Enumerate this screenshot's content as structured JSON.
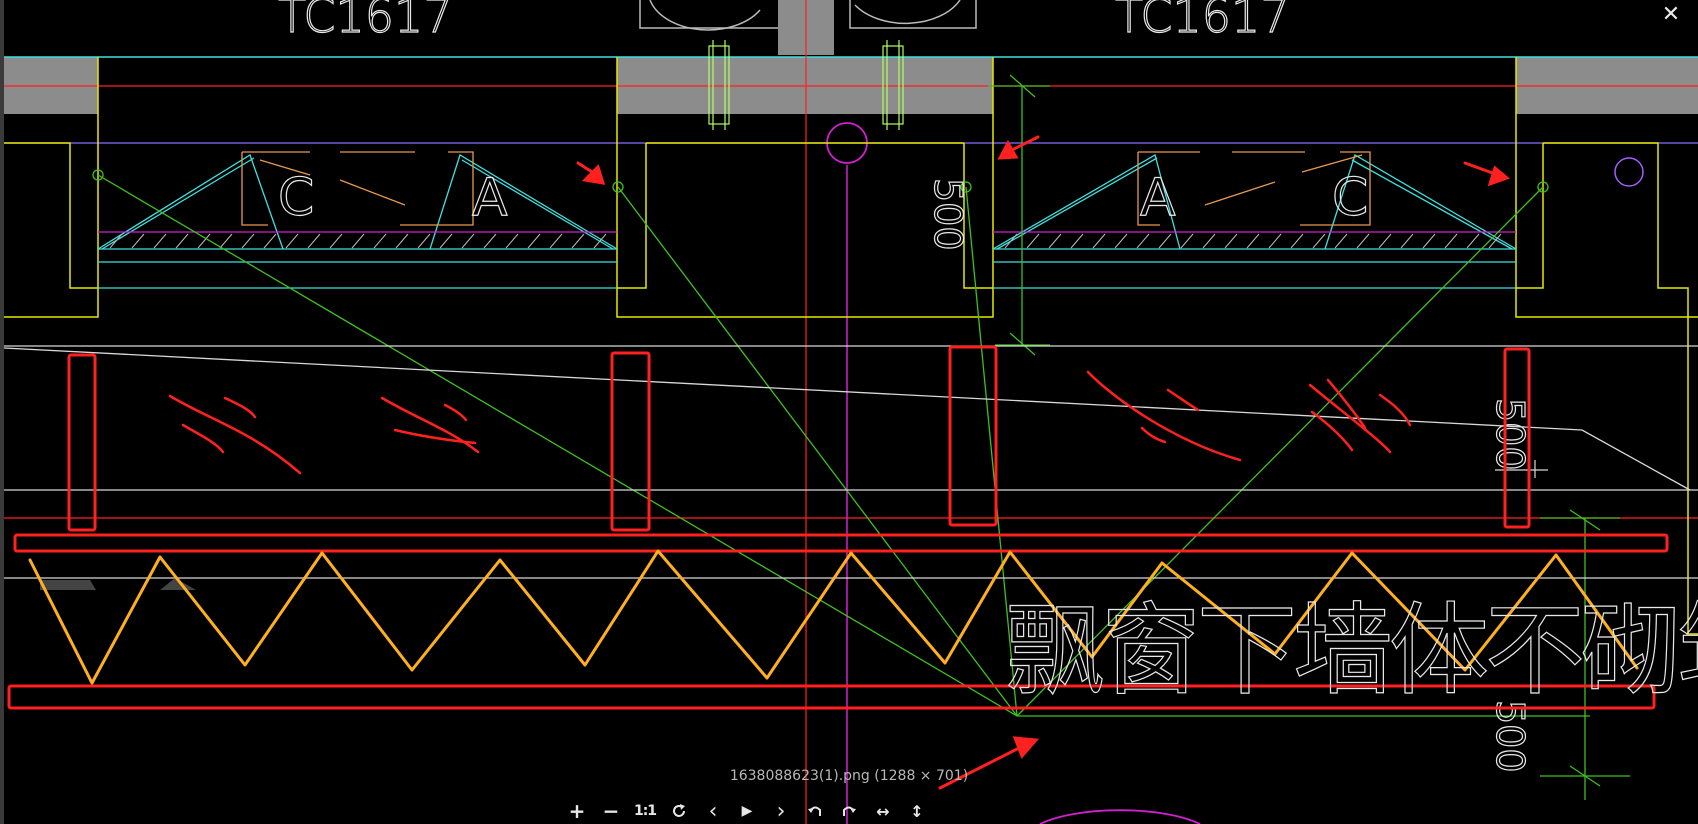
{
  "viewer": {
    "file_caption": "1638088623(1).png (1288 × 701)",
    "close_label": "✕"
  },
  "drawing": {
    "window_tags": [
      "TC1617",
      "TC1617"
    ],
    "door_labels": [
      "C",
      "A",
      "A",
      "C"
    ],
    "annotation_text": "飘窗下墙体不砌筑",
    "dimension_text_a": "500",
    "dimension_text_b": "500",
    "dimension_text_c": "500"
  },
  "toolbar": {
    "zoom_in": "+",
    "zoom_out": "−",
    "actual_size": "1:1",
    "rotate": "refresh-icon",
    "prev": "‹",
    "play": "▶",
    "next": "›",
    "undo": "undo-icon",
    "redo": "redo-icon",
    "fit_width": "↔",
    "fit_height": "↕"
  },
  "colors": {
    "background": "#000000",
    "wall_fill": "#8c8c8c",
    "yellow_line": "#e8e800",
    "cyan_line": "#3fe0e0",
    "red_line": "#ff2020",
    "green_line": "#40c020",
    "magenta_line": "#d020d0",
    "orange_zigzag": "#ffb020",
    "highlight_red": "#ff2020",
    "white_line": "#d8d8d8"
  }
}
